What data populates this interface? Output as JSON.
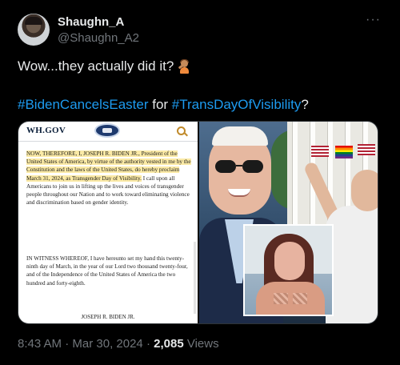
{
  "author": {
    "name": "Shaughn_A",
    "handle": "@Shaughn_A2",
    "avatar_icon": "avatar-photo"
  },
  "more_label": "···",
  "tweet": {
    "line1": "Wow...they actually did it?",
    "line1_emoji": "person-shrugging-emoji",
    "hashtag1": "#BidenCancelsEaster",
    "connector": "for",
    "hashtag2": "#TransDayOfVisibility",
    "question_mark": "?"
  },
  "media": {
    "document": {
      "site": "WH.GOV",
      "paragraph1_highlight": "NOW, THEREFORE, I, JOSEPH R. BIDEN JR., President of the United States of America, by virtue of the authority vested in me by the Constitution and the laws of the United States, do hereby proclaim March 31, 2024, as Transgender Day of Visibility.",
      "paragraph1_rest": "I call upon all Americans to join us in lifting up the lives and voices of transgender people throughout our Nation and to work toward eliminating violence and discrimination based on gender identity.",
      "paragraph2": "IN WITNESS WHEREOF, I have hereunto set my hand this twenty-ninth day of March, in the year of our Lord two thousand twenty-four, and of the Independence of the United States of America the two hundred and forty-eighth.",
      "signature": "JOSEPH R. BIDEN JR."
    }
  },
  "footer": {
    "time": "8:43 AM",
    "sep1": " · ",
    "date": "Mar 30, 2024",
    "sep2": " · ",
    "views_count": "2,085",
    "views_label": " Views"
  },
  "colors": {
    "background": "#000000",
    "text": "#e7e9ea",
    "muted": "#71767b",
    "link": "#1d9bf0",
    "highlight": "#fbeaa6"
  }
}
